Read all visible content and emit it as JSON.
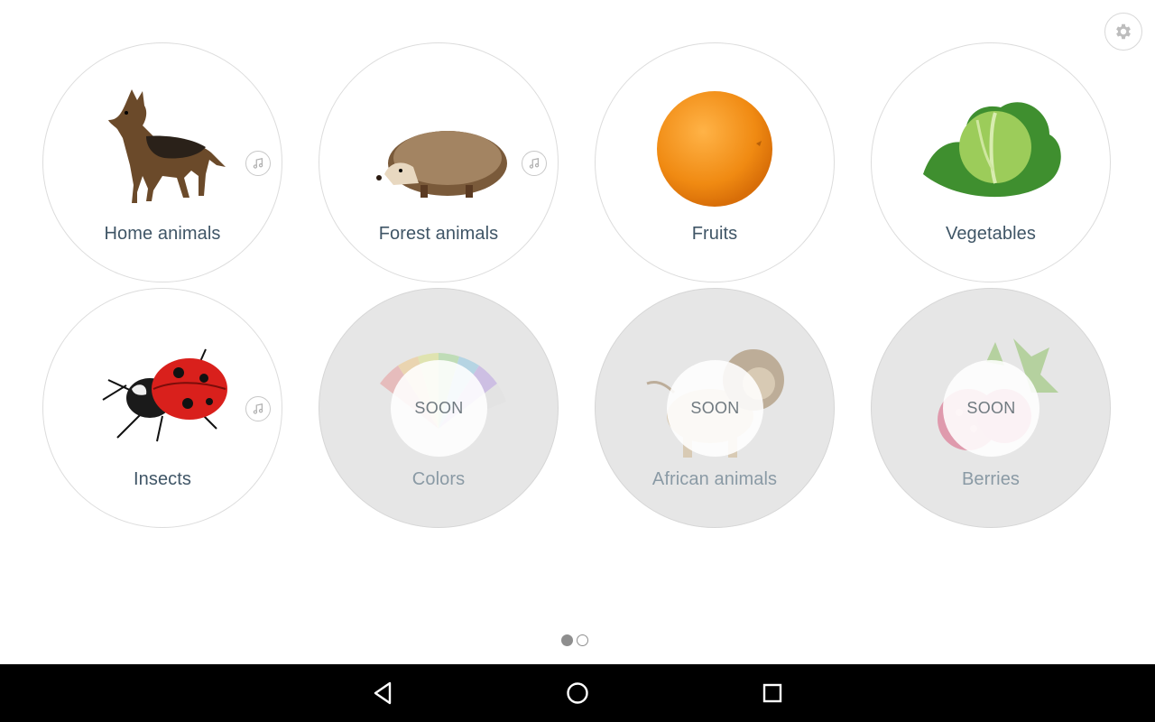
{
  "header": {
    "settings_icon": "gear-icon"
  },
  "categories": [
    {
      "label": "Home animals",
      "image": "dog",
      "sound": true,
      "locked": false
    },
    {
      "label": "Forest animals",
      "image": "hedgehog",
      "sound": true,
      "locked": false
    },
    {
      "label": "Fruits",
      "image": "orange",
      "sound": false,
      "locked": false
    },
    {
      "label": "Vegetables",
      "image": "cabbage",
      "sound": false,
      "locked": false
    },
    {
      "label": "Insects",
      "image": "ladybug",
      "sound": true,
      "locked": false
    },
    {
      "label": "Colors",
      "image": "color-fan",
      "sound": false,
      "locked": true,
      "badge": "SOON"
    },
    {
      "label": "African animals",
      "image": "lion",
      "sound": false,
      "locked": true,
      "badge": "SOON"
    },
    {
      "label": "Berries",
      "image": "raspberry",
      "sound": false,
      "locked": true,
      "badge": "SOON"
    }
  ],
  "pager": {
    "total": 2,
    "current": 1
  },
  "navbar": {
    "buttons": [
      "back-icon",
      "home-icon",
      "recents-icon"
    ]
  },
  "colors": {
    "label": "#3f5566",
    "locked_bg": "#e6e6e6",
    "navbar": "#000000"
  }
}
